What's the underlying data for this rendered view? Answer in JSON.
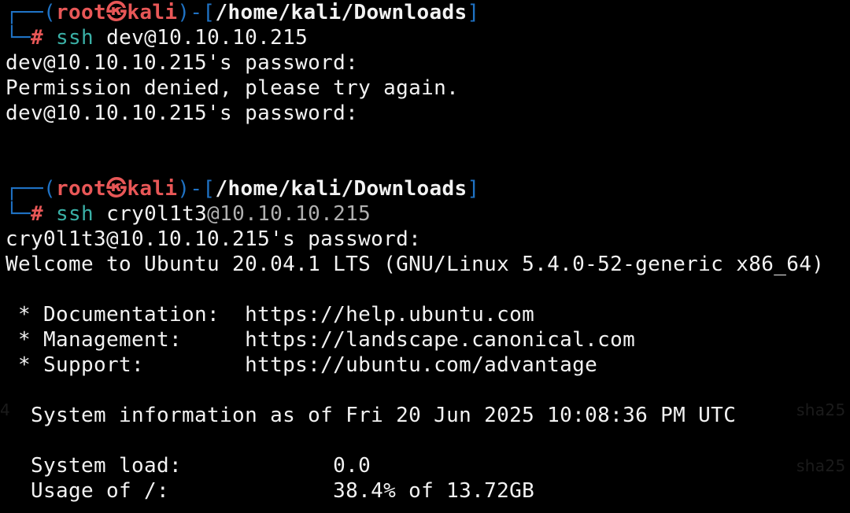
{
  "prompt1": {
    "box_top": "┌──",
    "user": "root",
    "skull": "㉿",
    "host": "kali",
    "sep": ")-[",
    "path": "/home/kali/Downloads",
    "close": "]",
    "box_bottom": "└─",
    "hash": "#",
    "command": "ssh",
    "argument": "dev@10.10.10.215"
  },
  "output1": [
    "dev@10.10.10.215's password:",
    "Permission denied, please try again.",
    "dev@10.10.10.215's password:"
  ],
  "prompt2": {
    "box_top": "┌──",
    "user": "root",
    "skull": "㉿",
    "host": "kali",
    "sep": ")-[",
    "path": "/home/kali/Downloads",
    "close": "]",
    "box_bottom": "└─",
    "hash": "#",
    "command": "ssh",
    "arg_user": "cry0l1t3",
    "arg_host": "@10.10.10.215"
  },
  "output2": {
    "password_prompt": "cry0l1t3@10.10.10.215's password:",
    "welcome": "Welcome to Ubuntu 20.04.1 LTS (GNU/Linux 5.4.0-52-generic x86_64)",
    "links": [
      " * Documentation:  https://help.ubuntu.com",
      " * Management:     https://landscape.canonical.com",
      " * Support:        https://ubuntu.com/advantage"
    ],
    "sysinfo": "  System information as of Fri 20 Jun 2025 10:08:36 PM UTC",
    "system_load": "  System load:            0.0",
    "usage": "  Usage of /:             38.4% of 13.72GB"
  },
  "background_ghosts": {
    "left_digit": "4",
    "right_a": "sha25",
    "right_b": "sha25"
  },
  "colors": {
    "background": "#000000",
    "text": "#f2f2f2",
    "frame_blue": "#1f72c4",
    "user_red": "#e85757",
    "command_teal": "#3ab0a6"
  }
}
